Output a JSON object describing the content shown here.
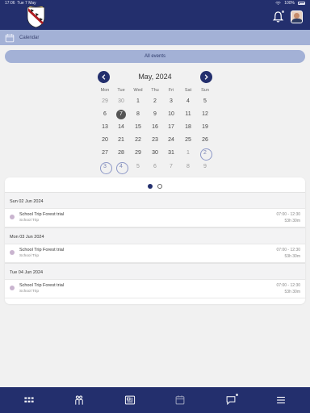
{
  "status_bar": {
    "time": "17:06",
    "date": "Tue 7 May",
    "battery": "100%"
  },
  "header": {
    "logo": "school-crest",
    "notifications_icon": "bell-icon",
    "avatar": "user-avatar"
  },
  "breadcrumb": {
    "icon": "calendar-icon",
    "label": "Calendar"
  },
  "filter": {
    "all_events_label": "All events"
  },
  "calendar": {
    "month_title": "May, 2024",
    "weekdays": [
      "Mon",
      "Tue",
      "Wed",
      "Thu",
      "Fri",
      "Sat",
      "Sun"
    ],
    "weeks": [
      [
        "29",
        "30",
        "1",
        "2",
        "3",
        "4",
        "5"
      ],
      [
        "6",
        "7",
        "8",
        "9",
        "10",
        "11",
        "12"
      ],
      [
        "13",
        "14",
        "15",
        "16",
        "17",
        "18",
        "19"
      ],
      [
        "20",
        "21",
        "22",
        "23",
        "24",
        "25",
        "26"
      ],
      [
        "27",
        "28",
        "29",
        "30",
        "31",
        "1",
        "2"
      ],
      [
        "3",
        "4",
        "5",
        "6",
        "7",
        "8",
        "9"
      ]
    ],
    "selected_day": "7",
    "event_days": [
      "2 Jun",
      "3 Jun",
      "4 Jun"
    ],
    "colors": {
      "accent": "#232f6d",
      "selected": "#555555",
      "event_ring": "#8d98c7"
    }
  },
  "pager": {
    "pages": 2,
    "active": 1
  },
  "events": [
    {
      "day_label": "Sun 02 Jun 2024",
      "title": "School Trip Forest trial",
      "type": "School Trip",
      "time": "07:00 - 12:30",
      "duration": "53h 30m"
    },
    {
      "day_label": "Mon 03 Jun 2024",
      "title": "School Trip Forest trial",
      "type": "School Trip",
      "time": "07:00 - 12:30",
      "duration": "53h 30m"
    },
    {
      "day_label": "Tue 04 Jun 2024",
      "title": "School Trip Forest trial",
      "type": "School Trip",
      "time": "07:00 - 12:30",
      "duration": "53h 30m"
    }
  ],
  "bottom_nav": {
    "tabs": [
      {
        "icon": "grid-icon"
      },
      {
        "icon": "people-icon"
      },
      {
        "icon": "news-icon"
      },
      {
        "icon": "calendar-icon",
        "active": true
      },
      {
        "icon": "chat-icon",
        "badge": true
      },
      {
        "icon": "menu-icon"
      }
    ]
  }
}
